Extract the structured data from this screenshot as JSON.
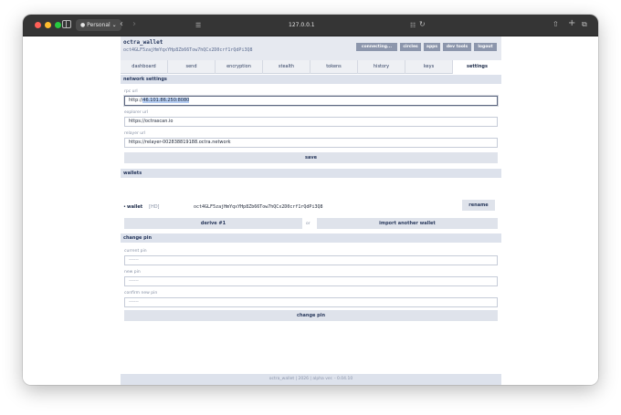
{
  "browser": {
    "profile_label": "Personal",
    "url": "127.0.0.1"
  },
  "header": {
    "title": "octra_wallet",
    "address": "oct4GLF5zajHmYqxYHp8Zb66Tow7hQCx2D0crf1rQdPi3Q8",
    "buttons": {
      "connecting": "connecting...",
      "circles": "circles",
      "apps": "apps",
      "dev_tools": "dev tools",
      "logout": "logout"
    }
  },
  "tabs": [
    "dashboard",
    "send",
    "encryption",
    "stealth",
    "tokens",
    "history",
    "keys",
    "settings"
  ],
  "active_tab": "settings",
  "network_settings": {
    "heading": "network settings",
    "rpc_label": "rpc url",
    "rpc_prefix": "http://",
    "rpc_selected": "46.101.86.250:8080",
    "explorer_label": "explorer url",
    "explorer_value": "https://octrascan.io",
    "relayer_label": "relayer url",
    "relayer_value": "https://relayer-002838819188.octra.network",
    "save_label": "save"
  },
  "wallets": {
    "heading": "wallets",
    "item": {
      "name": "wallet",
      "tag": "[HD]",
      "address": "oct4GLF5zajHmYqxYHp8Zb66Tow7hQCx2D0crf1rQdPi3Q8",
      "rename_label": "rename"
    },
    "derive_label": "derive #1",
    "or_label": "or",
    "import_label": "import another wallet"
  },
  "change_pin": {
    "heading": "change pin",
    "current_label": "current pin",
    "current_placeholder": "------",
    "new_label": "new pin",
    "new_placeholder": "------",
    "confirm_label": "confirm new pin",
    "confirm_placeholder": "------",
    "button_label": "change pin"
  },
  "footer": "octra_wallet | 2026 | alpha ver. - 0.04.10",
  "colors": {
    "header_bg": "#e6e9f0",
    "section_bg": "#dde2ec",
    "header_button": "#8c96ac",
    "accent_text": "#26375c"
  }
}
